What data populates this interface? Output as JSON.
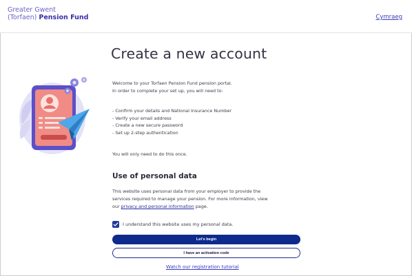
{
  "header": {
    "brand_line1": "Greater Gwent",
    "brand_line2_prefix": "(Torfaen)",
    "brand_line2_bold": "Pension Fund",
    "language_link": "Cymraeg"
  },
  "main": {
    "title": "Create a new account",
    "intro_line1": "Welcome to your Torfaen Pension Fund pension portal.",
    "intro_line2": "In order to complete your set up, you will need to:",
    "steps": [
      "- Confirm your details and National Insurance Number",
      "- Verify your email address",
      "- Create a new secure password",
      "- Set up 2-step authentication"
    ],
    "once_note": "You will only need to do this once."
  },
  "personal_data": {
    "heading": "Use of personal data",
    "text_line1": "This website uses personal data from your employer to provide the",
    "text_line2": "services required to manage your pension. For more information, view",
    "text_line3_prefix": "our",
    "policy_link": "privacy and personal information",
    "text_line3_suffix": "page.",
    "checkbox_label": "I understand this website uses my personal data.",
    "checkbox_checked": true
  },
  "actions": {
    "primary_label": "Let's begin",
    "secondary_label": "I have an activation code",
    "tutorial_link": "Watch our registration tutorial"
  },
  "colors": {
    "brand": "#3a2fa8",
    "primary_button": "#0e2a8c",
    "link": "#3b3bbf",
    "illustration_accent": "#e8706a"
  }
}
